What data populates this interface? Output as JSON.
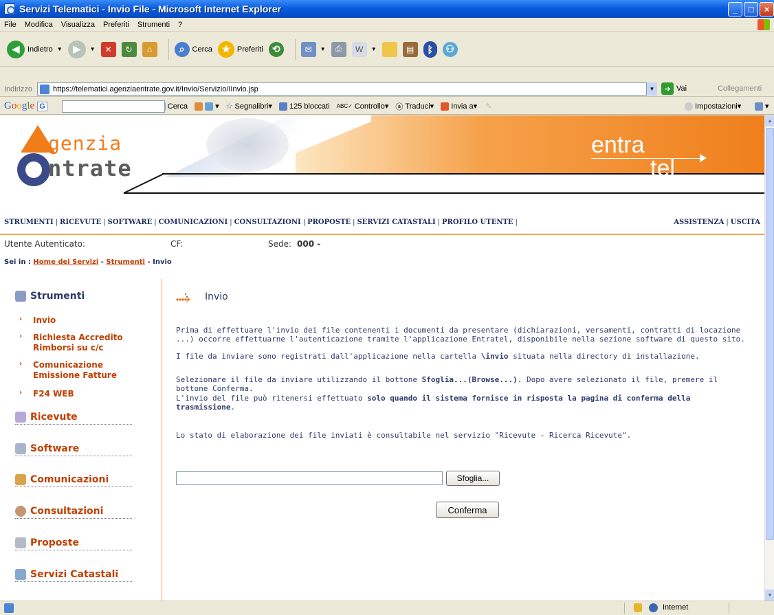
{
  "window": {
    "title": "Servizi Telematici - Invio File - Microsoft Internet Explorer",
    "minimize": "_",
    "maximize": "□",
    "close": "×"
  },
  "menu": [
    "File",
    "Modifica",
    "Visualizza",
    "Preferiti",
    "Strumenti",
    "?"
  ],
  "toolbar": {
    "back": "Indietro",
    "search": "Cerca",
    "favorites": "Preferiti"
  },
  "address": {
    "label": "Indirizzo",
    "url": "https://telematici.agenziaentrate.gov.it/Invio/Servizio/IInvio.jsp",
    "go": "Vai",
    "links": "Collegamenti"
  },
  "google": {
    "logo": "Google",
    "g_label": "G",
    "cerca": "Cerca",
    "segnalibri": "Segnalibri",
    "blocked": "125 bloccati",
    "controllo": "Controllo",
    "traduci": "Traduci",
    "invia": "Invia a",
    "impostazioni": "Impostazioni"
  },
  "banner": {
    "logo_top": "genzia",
    "logo_bottom": "ntrate",
    "entratel_1": "entra",
    "entratel_2": "tel"
  },
  "nav": {
    "left": [
      "STRUMENTI",
      "RICEVUTE",
      "SOFTWARE",
      "COMUNICAZIONI",
      "CONSULTAZIONI",
      "PROPOSTE",
      "SERVIZI CATASTALI",
      "PROFILO UTENTE"
    ],
    "right": [
      "ASSISTENZA",
      "USCITA"
    ]
  },
  "user": {
    "auth_label": "Utente Autenticato:",
    "cf_label": "CF:",
    "sede_label": "Sede:",
    "sede_value": "000 -"
  },
  "breadcrumb": {
    "prefix": "Sei in :",
    "home": "Home dei Servizi",
    "section": "Strumenti",
    "current": "Invio"
  },
  "sidebar": {
    "strumenti": "Strumenti",
    "subitems": [
      "Invio",
      "Richiesta Accredito Rimborsi su c/c",
      "Comunicazione Emissione Fatture",
      "F24 WEB"
    ],
    "sections": [
      "Ricevute",
      "Software",
      "Comunicazioni",
      "Consultazioni",
      "Proposte",
      "Servizi Catastali"
    ]
  },
  "main": {
    "title": "Invio",
    "p1": "Prima di effettuare l'invio dei file contenenti i documenti da presentare (dichiarazioni, versamenti, contratti di locazione ...) occorre effettuarne l'autenticazione tramite l'applicazione Entratel, disponibile nella sezione software di questo sito.",
    "p2_a": "I file da inviare sono registrati dall'applicazione nella cartella ",
    "p2_b": "\\invio",
    "p2_c": " situata nella directory di installazione.",
    "p3_a": "Selezionare il file da inviare utilizzando il bottone ",
    "p3_b": "Sfoglia...(Browse...)",
    "p3_c": ". Dopo avere selezionato il file, premere il bottone Conferma.",
    "p4_a": "L'invio del file può ritenersi effettuato ",
    "p4_b": "solo quando il sistema fornisce in risposta la pagina di conferma della trasmissione",
    "p4_c": ".",
    "p5": "Lo stato di elaborazione dei file inviati è consultabile nel servizio \"Ricevute - Ricerca Ricevute\".",
    "browse": "Sfoglia...",
    "confirm": "Conferma",
    "file_value": ""
  },
  "status": {
    "zone": "Internet"
  }
}
